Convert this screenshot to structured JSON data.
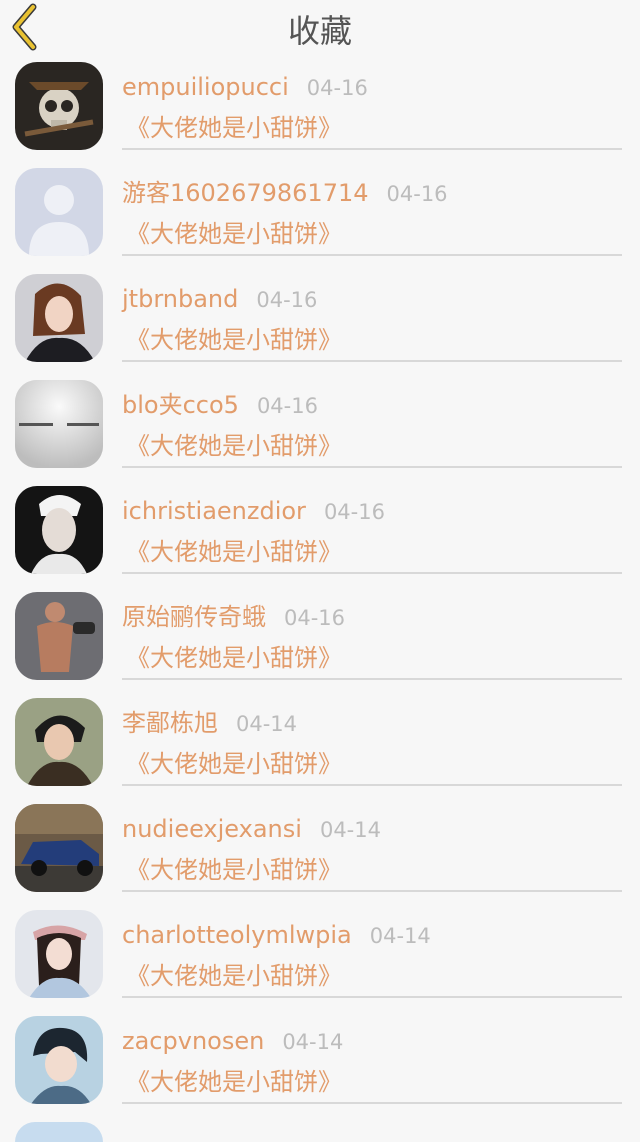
{
  "header": {
    "title": "收藏",
    "back_icon": "chevron-left-icon",
    "back_color": "#e9c232"
  },
  "colors": {
    "accent": "#e29c6b",
    "date": "#bcbcbc",
    "divider": "#d8d8d8"
  },
  "favorites": [
    {
      "user": "empuiliopucci",
      "date": "04-16",
      "book": "《大佬她是小甜饼》"
    },
    {
      "user": "游客1602679861714",
      "date": "04-16",
      "book": "《大佬她是小甜饼》"
    },
    {
      "user": "jtbrnband",
      "date": "04-16",
      "book": "《大佬她是小甜饼》"
    },
    {
      "user": "blo夹cco5",
      "date": "04-16",
      "book": "《大佬她是小甜饼》"
    },
    {
      "user": "ichristiaenzdior",
      "date": "04-16",
      "book": "《大佬她是小甜饼》"
    },
    {
      "user": "原始鹂传奇蛾",
      "date": "04-16",
      "book": "《大佬她是小甜饼》"
    },
    {
      "user": "李鄙栋旭",
      "date": "04-14",
      "book": "《大佬她是小甜饼》"
    },
    {
      "user": "nudieexjexansi",
      "date": "04-14",
      "book": "《大佬她是小甜饼》"
    },
    {
      "user": "charlotteolymlwpia",
      "date": "04-14",
      "book": "《大佬她是小甜饼》"
    },
    {
      "user": "zacpvnosen",
      "date": "04-14",
      "book": "《大佬她是小甜饼》"
    }
  ]
}
